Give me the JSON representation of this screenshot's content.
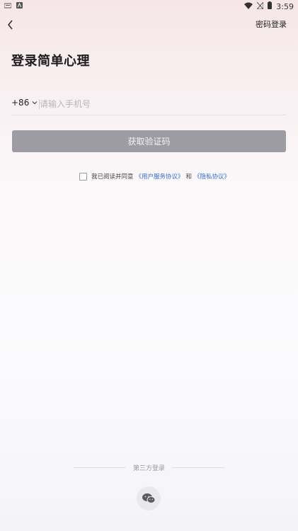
{
  "status_bar": {
    "time": "3:59"
  },
  "nav": {
    "password_login": "密码登录"
  },
  "title": "登录简单心理",
  "phone": {
    "country_code": "+86",
    "placeholder": "请输入手机号",
    "value": ""
  },
  "get_code_button": "获取验证码",
  "agreement": {
    "prefix": "我已阅读并同意",
    "user_agreement": "《用户服务协议》",
    "conjunction": "和",
    "privacy_policy": "《隐私协议》"
  },
  "third_party": {
    "label": "第三方登录",
    "providers": [
      "wechat-icon"
    ]
  },
  "colors": {
    "button_disabled": "#9c9ca2",
    "link": "#2f6fd0",
    "wechat_green": "#5a5a5a"
  }
}
